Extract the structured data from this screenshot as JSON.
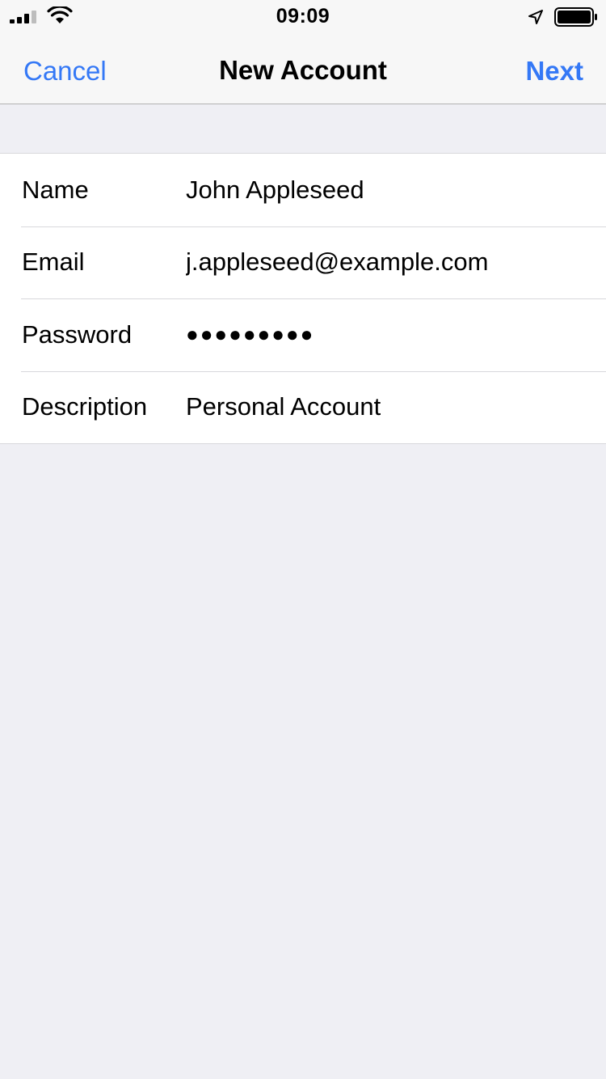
{
  "status_bar": {
    "time": "09:09",
    "icons": [
      "signal-icon",
      "wifi-icon",
      "location-arrow-icon",
      "battery-icon"
    ]
  },
  "nav": {
    "cancel_label": "Cancel",
    "title": "New Account",
    "next_label": "Next"
  },
  "form": {
    "fields": [
      {
        "label": "Name",
        "value": "John Appleseed"
      },
      {
        "label": "Email",
        "value": "j.appleseed@example.com"
      },
      {
        "label": "Password",
        "value": "●●●●●●●●●"
      },
      {
        "label": "Description",
        "value": "Personal Account"
      }
    ]
  },
  "colors": {
    "accent": "#3478f6",
    "background": "#efeff4",
    "bar_background": "#f7f7f7",
    "separator": "#d8d8dc"
  }
}
